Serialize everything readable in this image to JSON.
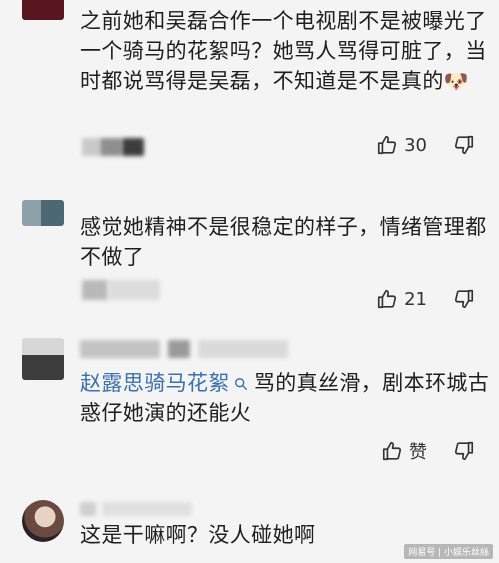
{
  "comments": [
    {
      "text": "之前她和吴磊合作一个电视剧不是被曝光了一个骑马的花絮吗？她骂人骂得可脏了，当时都说骂得是吴磊，不知道是不是真的",
      "emoji": "🐶",
      "likes": "30"
    },
    {
      "text": "感觉她精神不是很稳定的样子，情绪管理都不做了",
      "likes": "21"
    },
    {
      "link": "赵露思骑马花絮",
      "text": "骂的真丝滑，剧本环城古惑仔她演的还能火",
      "like_label": "赞"
    },
    {
      "text": "这是干嘛啊？没人碰她啊"
    }
  ],
  "watermark": "网易号 | 小娱乐丝絲",
  "colors": {
    "link": "#3a6fb0",
    "background": "#f4f4f4"
  }
}
